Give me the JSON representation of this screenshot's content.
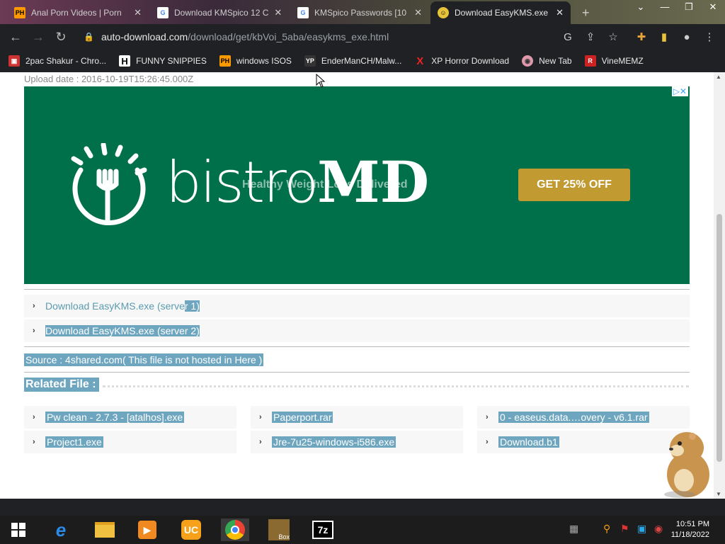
{
  "browser": {
    "tabs": [
      {
        "title": "Anal Porn Videos | Porn",
        "icon": "PH"
      },
      {
        "title": "Download KMSpico 12 C",
        "icon": "G"
      },
      {
        "title": "KMSpico Passwords [10",
        "icon": "G"
      },
      {
        "title": "Download EasyKMS.exe",
        "icon": "smiley"
      }
    ],
    "new_tab_label": "+",
    "url_host": "auto-download.com",
    "url_path": "/download/get/kbVoi_5aba/easykms_exe.html"
  },
  "bookmarks": [
    {
      "label": "2pac Shakur - Chro...",
      "icon": "D"
    },
    {
      "label": "FUNNY SNIPPIES",
      "icon": "H"
    },
    {
      "label": "windows ISOS",
      "icon": "PH"
    },
    {
      "label": "EnderManCH/Malw...",
      "icon": "YP"
    },
    {
      "label": "XP Horror Download",
      "icon": "X"
    },
    {
      "label": "New Tab",
      "icon": "globe"
    },
    {
      "label": "VineMEMZ",
      "icon": "R"
    }
  ],
  "page": {
    "upload_date": "Upload date : 2016-10-19T15:26:45.000Z",
    "ad": {
      "brand_light": "bistro",
      "brand_bold": "MD",
      "tagline": "Healthy Weight Loss Delivered",
      "cta": "GET 25% OFF"
    },
    "downloads": [
      {
        "plain": "Download EasyKMS.exe (serve",
        "highlight": "r 1)"
      },
      {
        "plain": "",
        "highlight": "Download EasyKMS.exe (server 2)"
      }
    ],
    "source": "Source : 4shared.com( This file is not hosted in Here )",
    "related_title": "Related File :",
    "related_files": [
      "Pw clean - 2.7.3 - [atalhos].exe",
      "Paperport.rar",
      "0 - easeus.data.…overy - v6.1.rar",
      "Project1.exe",
      "Jre-7u25-windows-i586.exe",
      "Download.b1"
    ]
  },
  "taskbar": {
    "time": "10:51 PM",
    "date": "11/18/2022"
  }
}
